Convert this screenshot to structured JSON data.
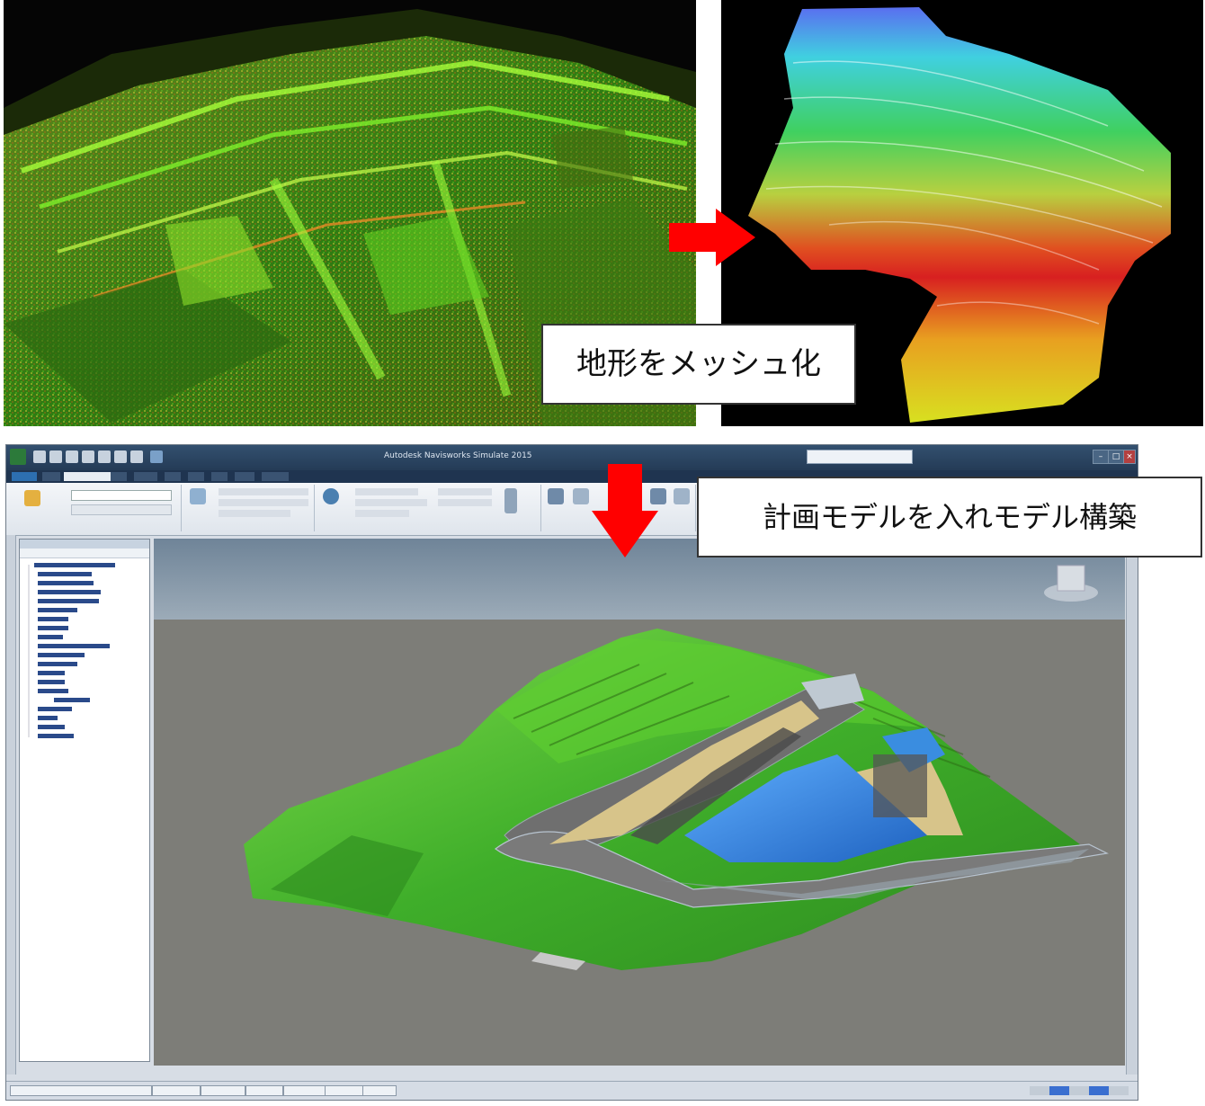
{
  "labels": {
    "mesh": "地形をメッシュ化",
    "model": "計画モデルを入れモデル構築"
  },
  "app": {
    "title": "Autodesk Navisworks Simulate 2015"
  },
  "colors": {
    "arrow": "#ff0000",
    "terrain_green": "#3fae2a",
    "water_blue": "#2f7fd6",
    "embankment": "#d7c48a"
  }
}
